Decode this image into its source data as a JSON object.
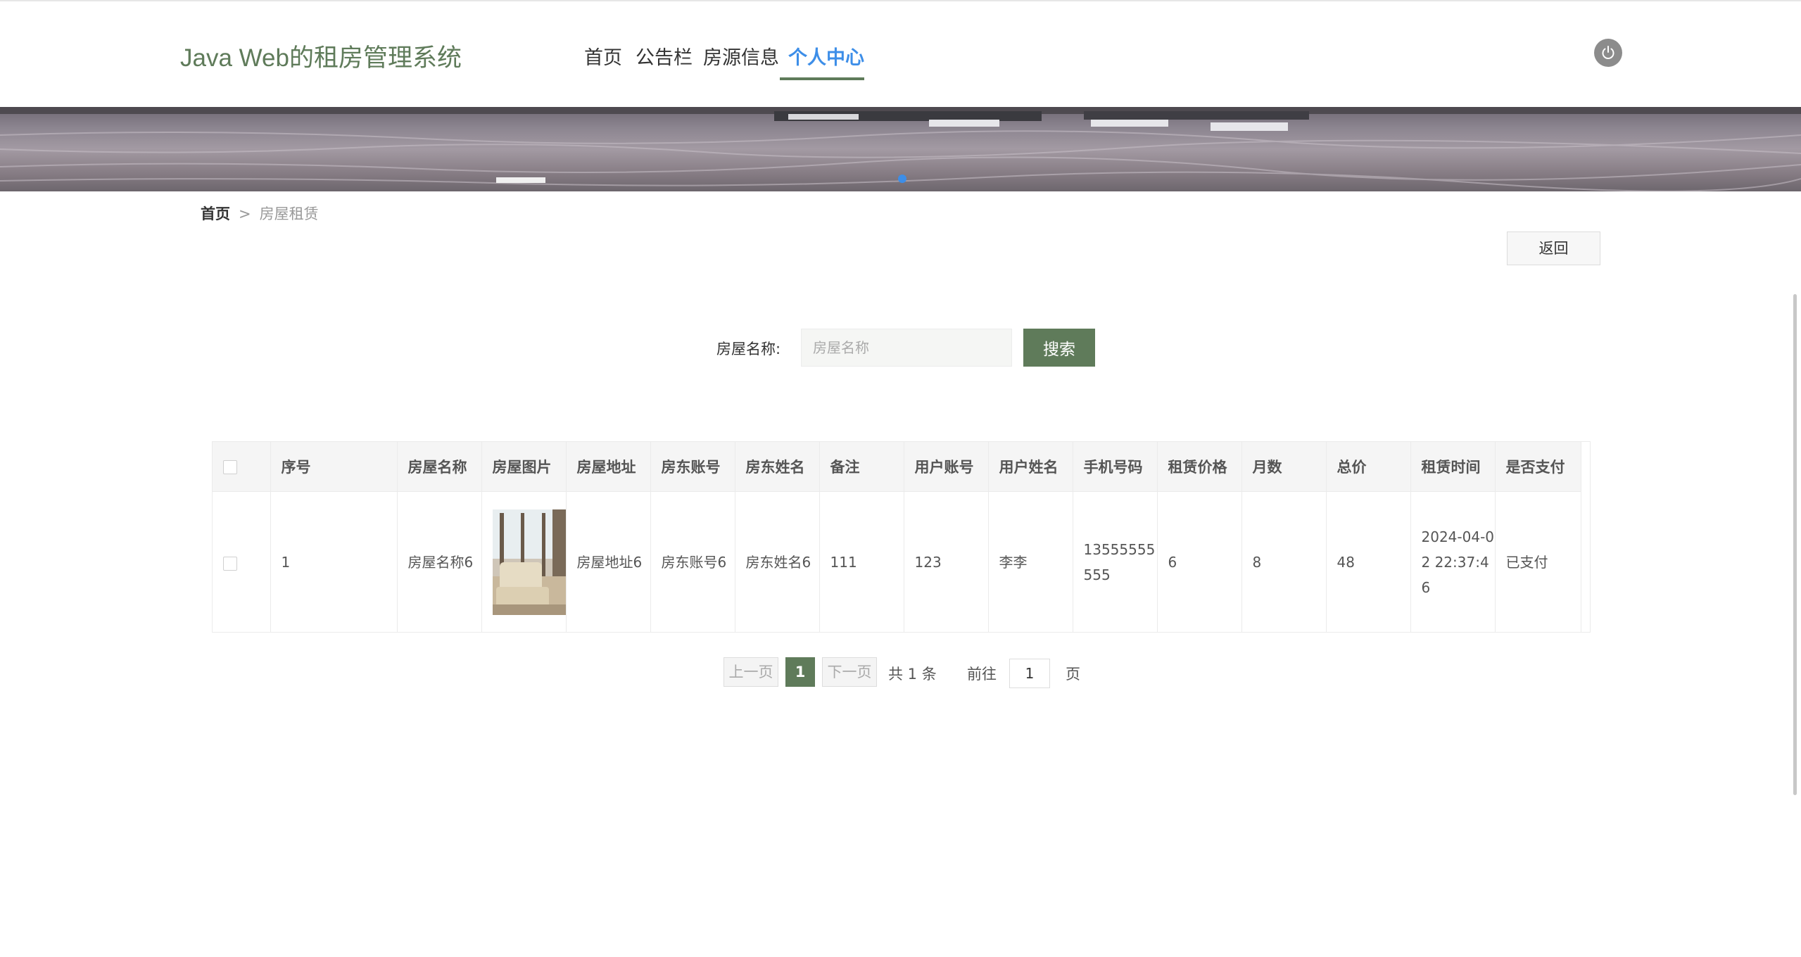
{
  "header": {
    "site_title": "Java Web的租房管理系统",
    "nav": [
      {
        "label": "首页",
        "active": false
      },
      {
        "label": "公告栏",
        "active": false
      },
      {
        "label": "房源信息",
        "active": false
      },
      {
        "label": "个人中心",
        "active": true
      }
    ]
  },
  "breadcrumb": {
    "home": "首页",
    "separator": ">",
    "current": "房屋租赁"
  },
  "back_button": "返回",
  "search": {
    "label": "房屋名称:",
    "placeholder": "房屋名称",
    "value": "",
    "button": "搜索"
  },
  "table": {
    "headers": [
      "序号",
      "房屋名称",
      "房屋图片",
      "房屋地址",
      "房东账号",
      "房东姓名",
      "备注",
      "用户账号",
      "用户姓名",
      "手机号码",
      "租赁价格",
      "月数",
      "总价",
      "租赁时间",
      "是否支付"
    ],
    "rows": [
      {
        "index": "1",
        "house_name": "房屋名称6",
        "house_address": "房屋地址6",
        "landlord_account": "房东账号6",
        "landlord_name": "房东姓名6",
        "remark": "111",
        "user_account": "123",
        "user_name": "李李",
        "phone": "13555555555",
        "price": "6",
        "months": "8",
        "total": "48",
        "rent_time": "2024-04-02 22:37:46",
        "paid": "已支付"
      }
    ]
  },
  "pagination": {
    "prev": "上一页",
    "current": "1",
    "next": "下一页",
    "total": "共 1 条",
    "goto_label": "前往",
    "goto_value": "1",
    "page_suffix": "页"
  },
  "colors": {
    "accent": "#5f7b5a",
    "active_nav": "#3d8ee8"
  }
}
